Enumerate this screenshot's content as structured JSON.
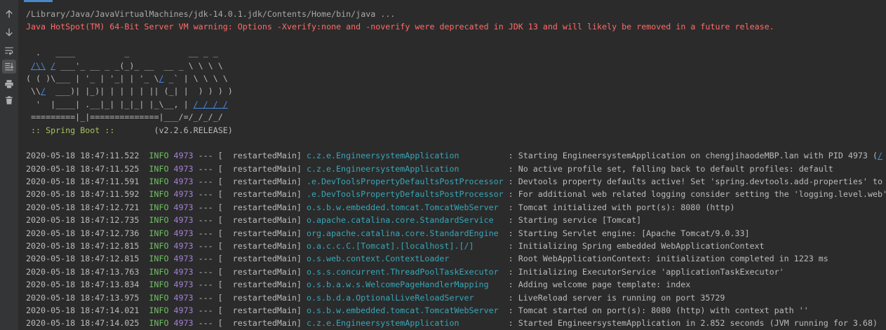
{
  "colors": {
    "background": "#2b2b2b",
    "toolbar_background": "#333537",
    "tab_indicator": "#4a88c7",
    "text": "#bbbbbb",
    "command": "#a9a9a9",
    "error": "#ff6b68",
    "level_info": "#6fbf62",
    "pid": "#a57fd6",
    "logger": "#37a6b9",
    "link": "#4a88dd",
    "banner_label": "#a6c35c",
    "icon": "#afb1b3"
  },
  "toolbar": {
    "icons": [
      "up-arrow-icon",
      "down-arrow-icon",
      "soft-wrap-icon",
      "scroll-to-end-icon",
      "print-icon",
      "trash-icon"
    ],
    "scroll_to_end_active": true
  },
  "console": {
    "command_line": "/Library/Java/JavaVirtualMachines/jdk-14.0.1.jdk/Contents/Home/bin/java ...",
    "warning_line": "Java HotSpot(TM) 64-Bit Server VM warning: Options -Xverify:none and -noverify were deprecated in JDK 13 and will likely be removed in a future release.",
    "banner": [
      [
        {
          "text": "  .   ____          _            __ _ _",
          "kind": "plain"
        }
      ],
      [
        {
          "text": " ",
          "kind": "plain"
        },
        {
          "text": "/\\\\",
          "kind": "link"
        },
        {
          "text": " ",
          "kind": "plain"
        },
        {
          "text": "/",
          "kind": "link"
        },
        {
          "text": " ___'_ __ _ _(_)_ __  __ _ \\ \\ \\ \\",
          "kind": "plain"
        }
      ],
      [
        {
          "text": "( ( )\\___ | '_ | '_| | '_ \\",
          "kind": "plain"
        },
        {
          "text": "/",
          "kind": "link"
        },
        {
          "text": " _` | \\ \\ \\ \\",
          "kind": "plain"
        }
      ],
      [
        {
          "text": " \\\\",
          "kind": "plain"
        },
        {
          "text": "/",
          "kind": "link"
        },
        {
          "text": "  ___)| |_)| | | | | || (_| |  ) ) ) )",
          "kind": "plain"
        }
      ],
      [
        {
          "text": "  '  |____| .__|_| |_|_| |_\\__, | ",
          "kind": "plain"
        },
        {
          "text": "/ / / /",
          "kind": "link"
        }
      ],
      [
        {
          "text": " =========|_|==============|___/=/_/_/_/",
          "kind": "plain"
        }
      ],
      [
        {
          "text": " ",
          "kind": "plain"
        },
        {
          "text": ":: Spring Boot ::",
          "kind": "label"
        },
        {
          "text": "        (v2.2.6.RELEASE)",
          "kind": "plain"
        }
      ]
    ],
    "log_format": {
      "dashes": "---",
      "thread_open": "[",
      "thread_close": "]",
      "message_separator": ":"
    },
    "logs": [
      {
        "timestamp": "2020-05-18 18:47:11.522",
        "level": "INFO",
        "pid": "4973",
        "thread": "restartedMain",
        "logger": "c.z.e.EngineersystemApplication",
        "message": "Starting EngineersystemApplication on chengjihaodeMBP.lan with PID 4973 (",
        "message_link": "/"
      },
      {
        "timestamp": "2020-05-18 18:47:11.525",
        "level": "INFO",
        "pid": "4973",
        "thread": "restartedMain",
        "logger": "c.z.e.EngineersystemApplication",
        "message": "No active profile set, falling back to default profiles: default"
      },
      {
        "timestamp": "2020-05-18 18:47:11.591",
        "level": "INFO",
        "pid": "4973",
        "thread": "restartedMain",
        "logger": ".e.DevToolsPropertyDefaultsPostProcessor",
        "message": "Devtools property defaults active! Set 'spring.devtools.add-properties' to"
      },
      {
        "timestamp": "2020-05-18 18:47:11.592",
        "level": "INFO",
        "pid": "4973",
        "thread": "restartedMain",
        "logger": ".e.DevToolsPropertyDefaultsPostProcessor",
        "message": "For additional web related logging consider setting the 'logging.level.web'"
      },
      {
        "timestamp": "2020-05-18 18:47:12.721",
        "level": "INFO",
        "pid": "4973",
        "thread": "restartedMain",
        "logger": "o.s.b.w.embedded.tomcat.TomcatWebServer",
        "message": "Tomcat initialized with port(s): 8080 (http)"
      },
      {
        "timestamp": "2020-05-18 18:47:12.735",
        "level": "INFO",
        "pid": "4973",
        "thread": "restartedMain",
        "logger": "o.apache.catalina.core.StandardService",
        "message": "Starting service [Tomcat]"
      },
      {
        "timestamp": "2020-05-18 18:47:12.736",
        "level": "INFO",
        "pid": "4973",
        "thread": "restartedMain",
        "logger": "org.apache.catalina.core.StandardEngine",
        "message": "Starting Servlet engine: [Apache Tomcat/9.0.33]"
      },
      {
        "timestamp": "2020-05-18 18:47:12.815",
        "level": "INFO",
        "pid": "4973",
        "thread": "restartedMain",
        "logger": "o.a.c.c.C.[Tomcat].[localhost].[/]",
        "message": "Initializing Spring embedded WebApplicationContext"
      },
      {
        "timestamp": "2020-05-18 18:47:12.815",
        "level": "INFO",
        "pid": "4973",
        "thread": "restartedMain",
        "logger": "o.s.web.context.ContextLoader",
        "message": "Root WebApplicationContext: initialization completed in 1223 ms"
      },
      {
        "timestamp": "2020-05-18 18:47:13.763",
        "level": "INFO",
        "pid": "4973",
        "thread": "restartedMain",
        "logger": "o.s.s.concurrent.ThreadPoolTaskExecutor",
        "message": "Initializing ExecutorService 'applicationTaskExecutor'"
      },
      {
        "timestamp": "2020-05-18 18:47:13.834",
        "level": "INFO",
        "pid": "4973",
        "thread": "restartedMain",
        "logger": "o.s.b.a.w.s.WelcomePageHandlerMapping",
        "message": "Adding welcome page template: index"
      },
      {
        "timestamp": "2020-05-18 18:47:13.975",
        "level": "INFO",
        "pid": "4973",
        "thread": "restartedMain",
        "logger": "o.s.b.d.a.OptionalLiveReloadServer",
        "message": "LiveReload server is running on port 35729"
      },
      {
        "timestamp": "2020-05-18 18:47:14.021",
        "level": "INFO",
        "pid": "4973",
        "thread": "restartedMain",
        "logger": "o.s.b.w.embedded.tomcat.TomcatWebServer",
        "message": "Tomcat started on port(s): 8080 (http) with context path ''"
      },
      {
        "timestamp": "2020-05-18 18:47:14.025",
        "level": "INFO",
        "pid": "4973",
        "thread": "restartedMain",
        "logger": "c.z.e.EngineersystemApplication",
        "message": "Started EngineersystemApplication in 2.852 seconds (JVM running for 3.68)"
      }
    ]
  }
}
